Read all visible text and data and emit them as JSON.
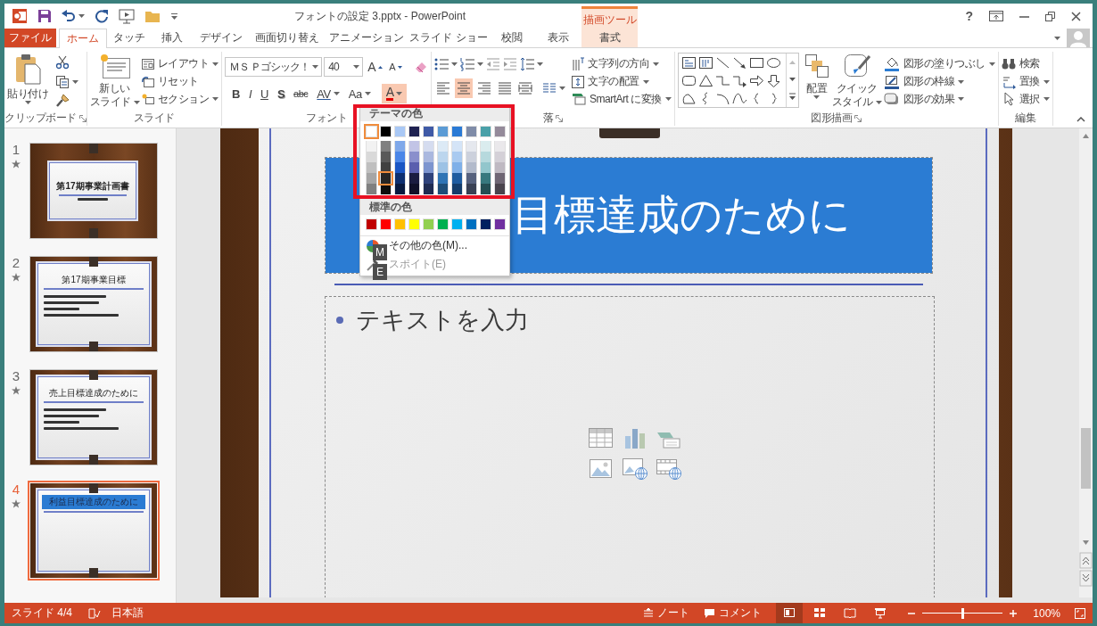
{
  "window": {
    "title": "フォントの設定 3.pptx - PowerPoint",
    "contextual_tab_group": "描画ツール",
    "help": "?"
  },
  "ribbon_tabs": [
    {
      "label": "ファイル",
      "kind": "file",
      "selected": false
    },
    {
      "label": "ホーム",
      "kind": "tab",
      "selected": true
    },
    {
      "label": "タッチ",
      "kind": "tab",
      "selected": false
    },
    {
      "label": "挿入",
      "kind": "tab",
      "selected": false
    },
    {
      "label": "デザイン",
      "kind": "tab",
      "selected": false
    },
    {
      "label": "画面切り替え",
      "kind": "tab",
      "selected": false
    },
    {
      "label": "アニメーション",
      "kind": "tab",
      "selected": false
    },
    {
      "label": "スライド ショー",
      "kind": "tab",
      "selected": false
    },
    {
      "label": "校閲",
      "kind": "tab",
      "selected": false
    },
    {
      "label": "表示",
      "kind": "tab",
      "selected": false
    },
    {
      "label": "書式",
      "kind": "contextual",
      "selected": false
    }
  ],
  "ribbon_groups": [
    {
      "kind": "clipboard",
      "label": "クリップボード",
      "paste": "貼り付け"
    },
    {
      "kind": "slides",
      "label": "スライド",
      "new_slide": [
        "新しい",
        "スライド"
      ],
      "commands": [
        {
          "label": "レイアウト",
          "dropdown": true
        },
        {
          "label": "リセット",
          "dropdown": false
        },
        {
          "label": "セクション",
          "dropdown": true
        }
      ]
    },
    {
      "kind": "font",
      "label": "フォント",
      "font_name": "ＭＳ Ｐゴシック！",
      "font_size": "40",
      "size_buttons": [
        "A",
        "A"
      ],
      "format_buttons": [
        "B",
        "I",
        "U",
        "S",
        "abc",
        "AV",
        "Aa"
      ],
      "font_color": {
        "label": "A",
        "pressed": true
      }
    },
    {
      "kind": "paragraph",
      "label": "落",
      "alignment": [
        {
          "selected": false
        },
        {
          "selected": true
        },
        {
          "selected": false
        },
        {
          "selected": false
        },
        {
          "selected": false
        }
      ],
      "commands": [
        {
          "label": "文字列の方向",
          "dropdown": true
        },
        {
          "label": "文字の配置",
          "dropdown": true
        },
        {
          "label": "SmartArt に変換",
          "dropdown": true
        }
      ]
    },
    {
      "kind": "drawing",
      "label": "図形描画",
      "arrange": "配置",
      "quick_styles": [
        "クイック",
        "スタイル"
      ],
      "commands": [
        {
          "label": "図形の塗りつぶし",
          "dropdown": true
        },
        {
          "label": "図形の枠線",
          "dropdown": true
        },
        {
          "label": "図形の効果",
          "dropdown": true
        }
      ]
    },
    {
      "kind": "editing",
      "label": "編集",
      "commands": [
        {
          "label": "検索",
          "dropdown": false
        },
        {
          "label": "置換",
          "dropdown": true
        },
        {
          "label": "選択",
          "dropdown": true
        }
      ]
    }
  ],
  "thumbnails": [
    {
      "number": "1",
      "title": "第17期事業計画書",
      "kind": "title",
      "selected": false
    },
    {
      "number": "2",
      "title": "第17期事業目標",
      "kind": "content",
      "selected": false
    },
    {
      "number": "3",
      "title": "売上目標達成のために",
      "kind": "content",
      "selected": false
    },
    {
      "number": "4",
      "title": "利益目標達成のために",
      "kind": "header",
      "selected": true
    }
  ],
  "slide": {
    "title": "目標達成のために",
    "placeholder": "テキストを入力"
  },
  "font_color_menu": {
    "theme_heading": "テーマの色",
    "theme_rows": [
      [
        {
          "color": "#ffffff",
          "selected": true
        },
        {
          "color": "#000000",
          "selected": false
        },
        {
          "color": "#a9c8f5",
          "selected": false
        },
        {
          "color": "#1f2251",
          "selected": false
        },
        {
          "color": "#3f5aa6",
          "selected": false
        },
        {
          "color": "#5b9bd5",
          "selected": false
        },
        {
          "color": "#2a7ad5",
          "selected": false
        },
        {
          "color": "#7f8ca8",
          "selected": false
        },
        {
          "color": "#4aa0a8",
          "selected": false
        },
        {
          "color": "#948a9a",
          "selected": false
        }
      ],
      [
        {
          "color": "#f2f2f2",
          "selected": false
        },
        {
          "color": "#7f7f7f",
          "selected": false
        },
        {
          "color": "#7fa8ea",
          "selected": false
        },
        {
          "color": "#c2c4e6",
          "selected": false
        },
        {
          "color": "#d5dcef",
          "selected": false
        },
        {
          "color": "#dceaf6",
          "selected": false
        },
        {
          "color": "#d4e4f7",
          "selected": false
        },
        {
          "color": "#e5e8ee",
          "selected": false
        },
        {
          "color": "#daecee",
          "selected": false
        },
        {
          "color": "#eae8eb",
          "selected": false
        }
      ],
      [
        {
          "color": "#d9d9d9",
          "selected": false
        },
        {
          "color": "#595959",
          "selected": false
        },
        {
          "color": "#4a86e8",
          "selected": false
        },
        {
          "color": "#8a8fcc",
          "selected": false
        },
        {
          "color": "#aab8df",
          "selected": false
        },
        {
          "color": "#bcd6ee",
          "selected": false
        },
        {
          "color": "#a9caf0",
          "selected": false
        },
        {
          "color": "#ccd1dc",
          "selected": false
        },
        {
          "color": "#b6d9dd",
          "selected": false
        },
        {
          "color": "#d4d0d7",
          "selected": false
        }
      ],
      [
        {
          "color": "#bfbfbf",
          "selected": false
        },
        {
          "color": "#404040",
          "selected": false
        },
        {
          "color": "#1a56c4",
          "selected": false
        },
        {
          "color": "#5a5fae",
          "selected": false
        },
        {
          "color": "#7d95cf",
          "selected": false
        },
        {
          "color": "#9cc2e5",
          "selected": false
        },
        {
          "color": "#7fb0e8",
          "selected": false
        },
        {
          "color": "#b2bacb",
          "selected": false
        },
        {
          "color": "#92c6cc",
          "selected": false
        },
        {
          "color": "#bfb9c2",
          "selected": false
        }
      ],
      [
        {
          "color": "#a6a6a6",
          "selected": false
        },
        {
          "color": "#262626",
          "selected": true
        },
        {
          "color": "#0d2f70",
          "selected": false
        },
        {
          "color": "#1a1c40",
          "selected": false
        },
        {
          "color": "#2f437c",
          "selected": false
        },
        {
          "color": "#2e74b5",
          "selected": false
        },
        {
          "color": "#1e5ca0",
          "selected": false
        },
        {
          "color": "#57627e",
          "selected": false
        },
        {
          "color": "#37787e",
          "selected": false
        },
        {
          "color": "#6f6674",
          "selected": false
        }
      ],
      [
        {
          "color": "#808080",
          "selected": false
        },
        {
          "color": "#0d0d0d",
          "selected": false
        },
        {
          "color": "#081a40",
          "selected": false
        },
        {
          "color": "#0f1028",
          "selected": false
        },
        {
          "color": "#1f2c52",
          "selected": false
        },
        {
          "color": "#1e4e79",
          "selected": false
        },
        {
          "color": "#143d6b",
          "selected": false
        },
        {
          "color": "#3a4154",
          "selected": false
        },
        {
          "color": "#244f54",
          "selected": false
        },
        {
          "color": "#4a444d",
          "selected": false
        }
      ]
    ],
    "standard_heading": "標準の色",
    "standard_colors": [
      {
        "color": "#c00000",
        "selected": false
      },
      {
        "color": "#ff0000",
        "selected": false
      },
      {
        "color": "#ffc000",
        "selected": false
      },
      {
        "color": "#ffff00",
        "selected": false
      },
      {
        "color": "#92d050",
        "selected": false
      },
      {
        "color": "#00b050",
        "selected": false
      },
      {
        "color": "#00b0f0",
        "selected": false
      },
      {
        "color": "#0070c0",
        "selected": false
      },
      {
        "color": "#002060",
        "selected": false
      },
      {
        "color": "#7030a0",
        "selected": false
      }
    ],
    "more_colors": "その他の色(M)...",
    "eyedropper": {
      "label": "スポイト(E)",
      "disabled": true
    }
  },
  "key_tips": [
    "M",
    "E"
  ],
  "status_bar": {
    "slide": "スライド 4/4",
    "language": "日本語",
    "notes": "ノート",
    "comments": "コメント",
    "views": [
      {
        "selected": true
      },
      {
        "selected": false
      },
      {
        "selected": false
      },
      {
        "selected": false
      }
    ],
    "zoom": {
      "level": 0.5,
      "reading": "100%"
    }
  }
}
